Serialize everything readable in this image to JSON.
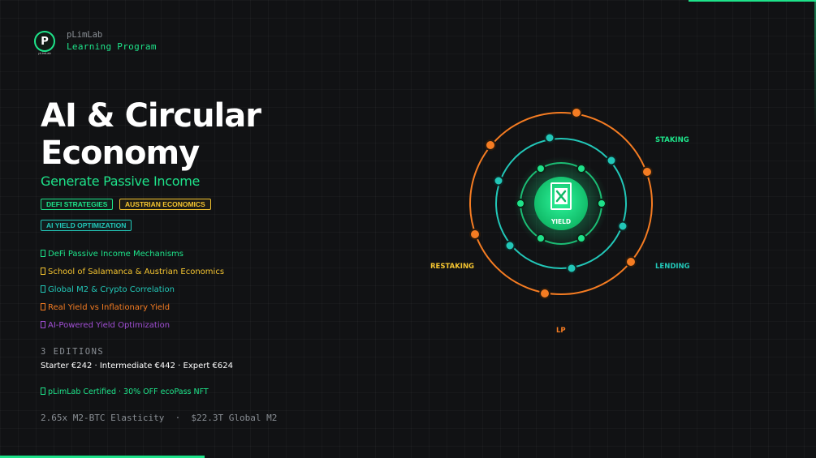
{
  "brand": {
    "name": "pLimLab",
    "program": "Learning Program",
    "logo_letter": "P",
    "logo_caption": "pLimLab"
  },
  "hero": {
    "title": "AI & Circular\nEconomy",
    "subtitle": "Generate Passive Income"
  },
  "tags": [
    {
      "label": "DEFI STRATEGIES",
      "color": "#1ee38a"
    },
    {
      "label": "AUSTRIAN ECONOMICS",
      "color": "#f4c430"
    },
    {
      "label": "AI YIELD OPTIMIZATION",
      "color": "#22c7b8"
    }
  ],
  "features": [
    {
      "label": "DeFi Passive Income Mechanisms",
      "color": "#1ee38a"
    },
    {
      "label": "School of Salamanca & Austrian Economics",
      "color": "#f4c430"
    },
    {
      "label": "Global M2 & Crypto Correlation",
      "color": "#22c7b8"
    },
    {
      "label": "Real Yield vs Inflationary Yield",
      "color": "#f57c22"
    },
    {
      "label": "AI-Powered Yield Optimization",
      "color": "#a24fd6"
    }
  ],
  "editions": {
    "label": "3 EDITIONS",
    "line": "Starter €242 · Intermediate €442 · Expert €624"
  },
  "certification": "pLimLab Certified · 30% OFF ecoPass NFT",
  "stats": "2.65x M2-BTC Elasticity  ·  $22.3T Global M2",
  "diagram": {
    "center_label": "YIELD",
    "labels": {
      "staking": "STAKING",
      "lending": "LENDING",
      "restaking": "RESTAKING",
      "lp": "LP"
    },
    "colors": {
      "outer_ring": "#f57c22",
      "middle_ring": "#22c7b8",
      "inner_ring": "#1ee38a",
      "restaking": "#f4c430"
    }
  }
}
